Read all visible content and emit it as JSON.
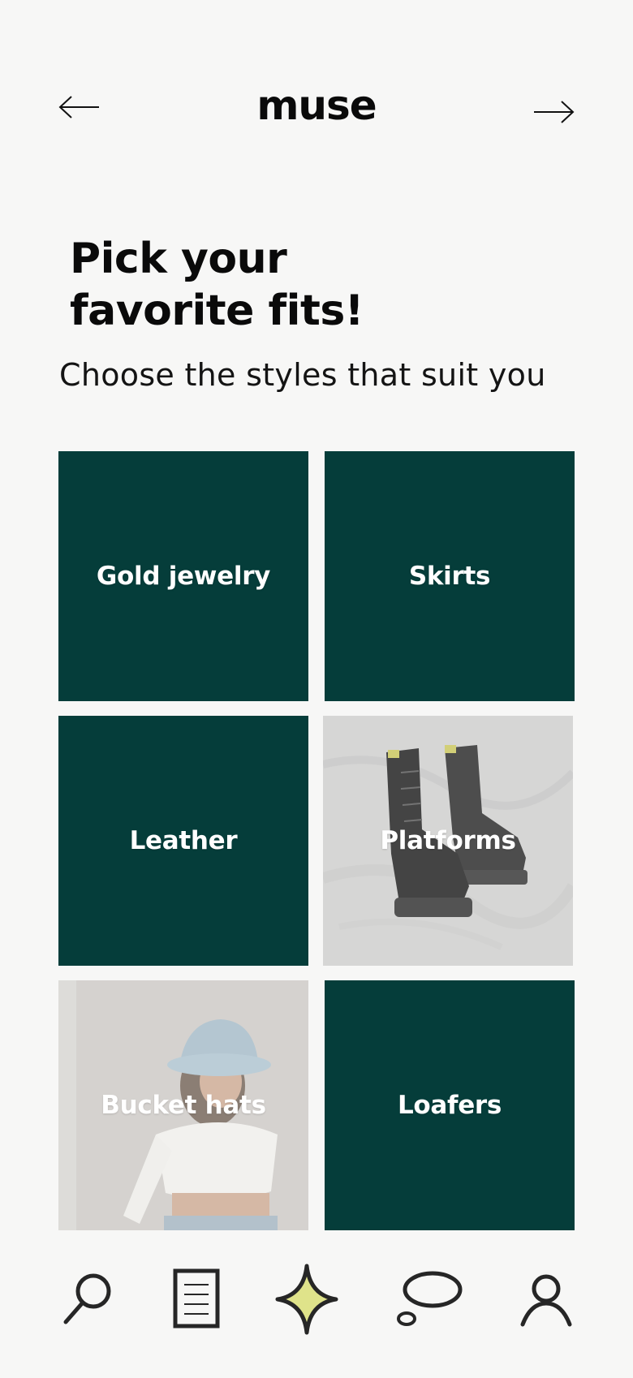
{
  "header": {
    "title": "muse",
    "back_icon": "arrow-left-icon",
    "forward_icon": "arrow-right-icon"
  },
  "intro": {
    "headline_line1": "Pick your",
    "headline_line2": "favorite fits!",
    "subtitle": "Choose the styles that suit you"
  },
  "styles": [
    {
      "label": "Gold jewelry"
    },
    {
      "label": "Skirts"
    },
    {
      "label": "Leather"
    },
    {
      "label": "Platforms"
    },
    {
      "label": "Bucket hats"
    },
    {
      "label": "Loafers"
    }
  ],
  "tabbar": {
    "items": [
      {
        "icon": "search-icon"
      },
      {
        "icon": "document-icon"
      },
      {
        "icon": "sparkle-icon",
        "active": true
      },
      {
        "icon": "chat-bubble-icon"
      },
      {
        "icon": "profile-icon"
      }
    ]
  },
  "colors": {
    "background": "#f7f7f6",
    "tile_green": "#053d3a",
    "sparkle_accent": "#dfe38a",
    "text": "#0a0a0a"
  }
}
